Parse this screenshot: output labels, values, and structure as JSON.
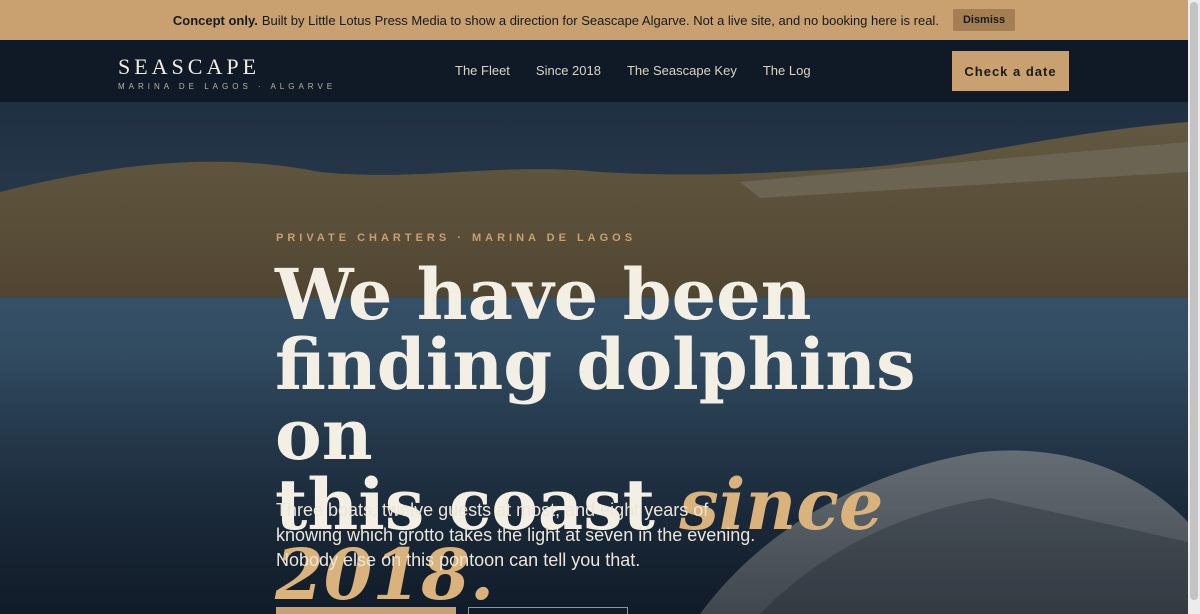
{
  "banner": {
    "lead": "Concept only.",
    "message": "Built by Little Lotus Press Media to show a direction for Seascape Algarve. Not a live site, and no booking here is real.",
    "dismiss": "Dismiss"
  },
  "brand": {
    "wordmark": "SEASCAPE",
    "tagline": "MARINA DE LAGOS · ALGARVE"
  },
  "nav": {
    "links": [
      "The Fleet",
      "Since 2018",
      "The Seascape Key",
      "The Log"
    ],
    "cta": "Check a date"
  },
  "hero": {
    "eyebrow": "PRIVATE CHARTERS · MARINA DE LAGOS",
    "headline_line1": "We have been",
    "headline_line2": "finding dolphins on",
    "headline_line3": "this coast",
    "headline_accent": "since 2018.",
    "lede": "Three boats, twelve guests at most, and eight years of knowing which grotto takes the light at seven in the evening. Nobody else on this pontoon can tell you that."
  },
  "colors": {
    "accent": "#c9a070",
    "nav_bg": "#101a26",
    "text_light": "#f3efe4"
  }
}
